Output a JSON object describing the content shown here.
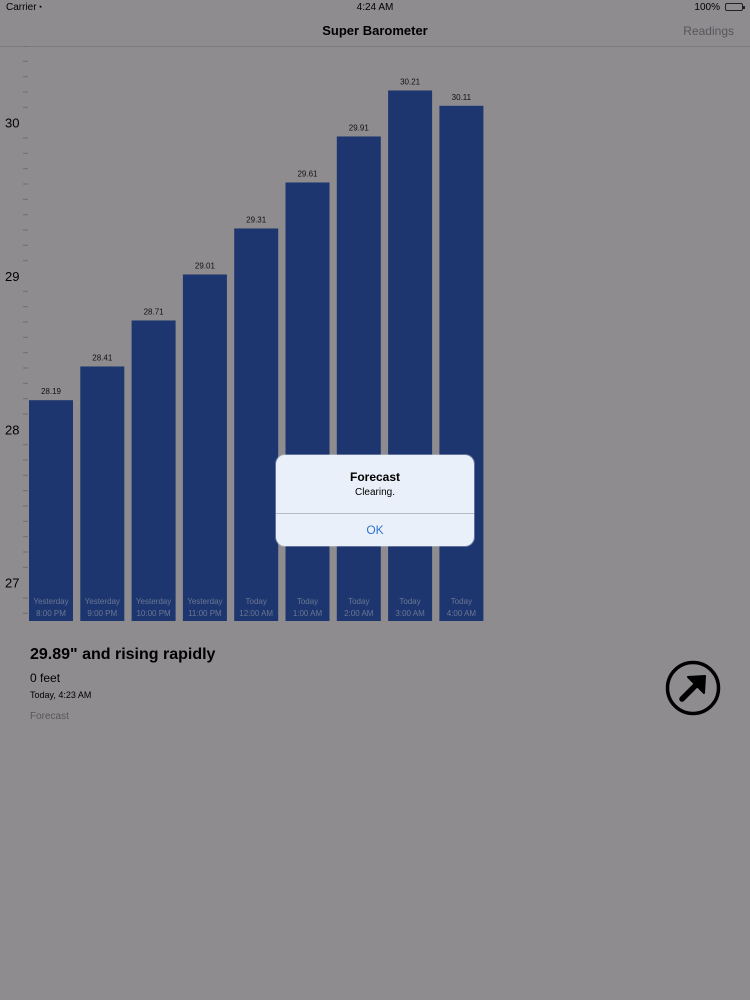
{
  "status_bar": {
    "carrier": "Carrier",
    "time": "4:24 AM",
    "battery": "100%"
  },
  "nav": {
    "title": "Super Barometer",
    "right_button": "Readings"
  },
  "chart_data": {
    "type": "bar",
    "categories": [
      [
        "Yesterday",
        "8:00 PM"
      ],
      [
        "Yesterday",
        "9:00 PM"
      ],
      [
        "Yesterday",
        "10:00 PM"
      ],
      [
        "Yesterday",
        "11:00 PM"
      ],
      [
        "Today",
        "12:00 AM"
      ],
      [
        "Today",
        "1:00 AM"
      ],
      [
        "Today",
        "2:00 AM"
      ],
      [
        "Today",
        "3:00 AM"
      ],
      [
        "Today",
        "4:00 AM"
      ]
    ],
    "values": [
      28.19,
      28.41,
      28.71,
      29.01,
      29.31,
      29.61,
      29.91,
      30.21,
      30.11
    ],
    "value_labels": [
      "28.19",
      "28.41",
      "28.71",
      "29.01",
      "29.31",
      "29.61",
      "29.91",
      "30.21",
      "30.11"
    ],
    "y_ticks": [
      27,
      28,
      29,
      30
    ],
    "ylim": [
      26.75,
      30.5
    ],
    "bar_color": "#1d3670",
    "grid": false
  },
  "summary": {
    "pressure": "29.89\" and rising rapidly",
    "altitude": "0 feet",
    "timestamp": "Today, 4:23 AM",
    "forecast_label": "Forecast"
  },
  "alert": {
    "title": "Forecast",
    "message": "Clearing.",
    "ok_label": "OK"
  },
  "icons": {
    "share": "arrow-up-right-circle-icon",
    "wifi": "wifi-icon",
    "battery": "battery-icon"
  }
}
